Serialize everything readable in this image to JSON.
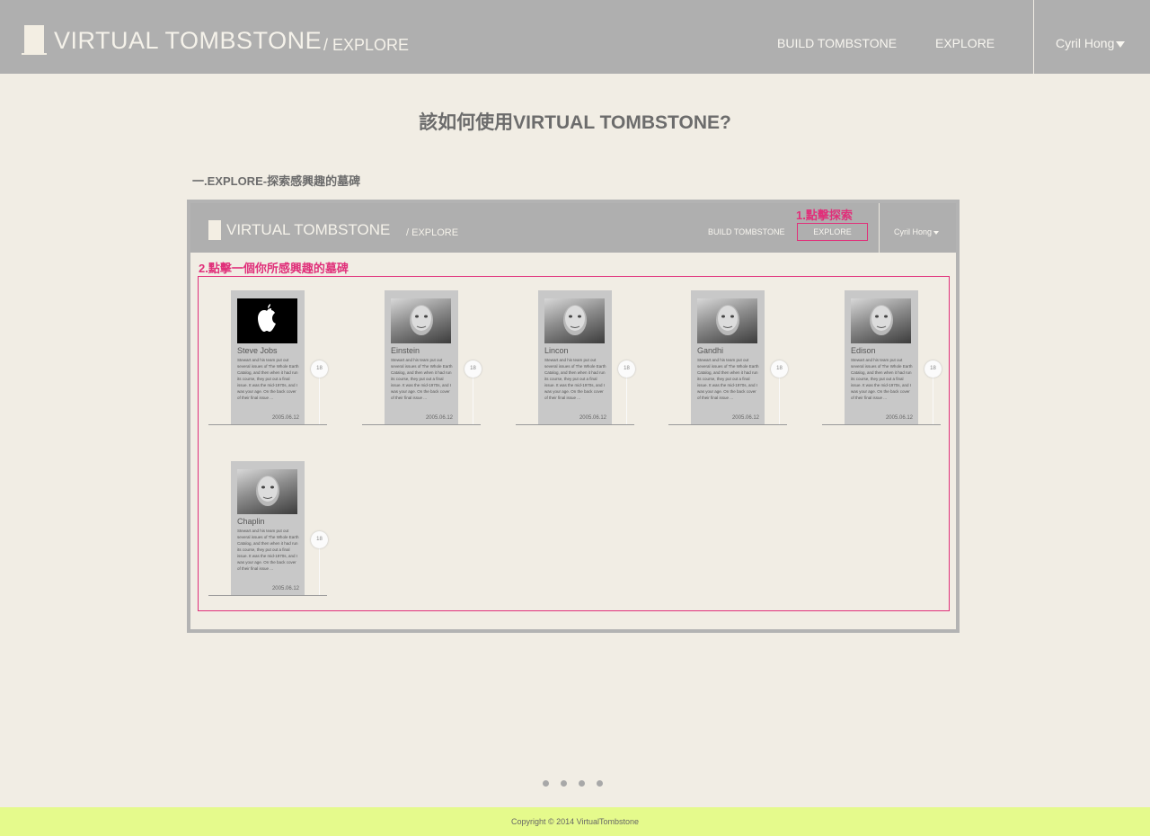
{
  "header": {
    "logo_title": "VIRTUAL TOMBSTONE",
    "logo_sub": "/ EXPLORE",
    "nav_build": "BUILD TOMBSTONE",
    "nav_explore": "EXPLORE",
    "user_name": "Cyril Hong"
  },
  "main": {
    "title": "該如何使用VIRTUAL TOMBSTONE?",
    "section_title": "一.EXPLORE-探索感興趣的墓碑"
  },
  "mock": {
    "logo_title": "VIRTUAL TOMBSTONE",
    "logo_sub": "/ EXPLORE",
    "nav_build": "BUILD TOMBSTONE",
    "nav_explore": "EXPLORE",
    "user_name": "Cyril Hong",
    "annotation_1": "1.點擊探索",
    "annotation_2": "2.點擊一個你所感興趣的墓碑",
    "tombs": [
      {
        "name": "Steve Jobs",
        "text": "Stewart and his team put out several issues of The Whole Earth Catalog, and then when it had run its course, they put out a final issue. It was the mid-1970s, and I was your age. On the back cover of their final issue ...",
        "date": "2005.06.12",
        "flowers": "18",
        "photo": "apple-logo"
      },
      {
        "name": "Einstein",
        "text": "Stewart and his team put out several issues of The Whole Earth Catalog, and then when it had run its course, they put out a final issue. It was the mid-1970s, and I was your age. On the back cover of their final issue ...",
        "date": "2005.06.12",
        "flowers": "18",
        "photo": "portrait"
      },
      {
        "name": "Lincon",
        "text": "Stewart and his team put out several issues of The Whole Earth Catalog, and then when it had run its course, they put out a final issue. It was the mid-1970s, and I was your age. On the back cover of their final issue ...",
        "date": "2005.06.12",
        "flowers": "18",
        "photo": "portrait"
      },
      {
        "name": "Gandhi",
        "text": "Stewart and his team put out several issues of The Whole Earth Catalog, and then when it had run its course, they put out a final issue. It was the mid-1970s, and I was your age. On the back cover of their final issue ...",
        "date": "2005.06.12",
        "flowers": "18",
        "photo": "portrait"
      },
      {
        "name": "Edison",
        "text": "Stewart and his team put out several issues of The Whole Earth Catalog, and then when it had run its course, they put out a final issue. It was the mid-1970s, and I was your age. On the back cover of their final issue ...",
        "date": "2005.06.12",
        "flowers": "18",
        "photo": "portrait"
      },
      {
        "name": "Chaplin",
        "text": "Stewart and his team put out several issues of The Whole Earth Catalog, and then when it had run its course, they put out a final issue. It was the mid-1970s, and I was your age. On the back cover of their final issue ...",
        "date": "2005.06.12",
        "flowers": "18",
        "photo": "portrait"
      }
    ]
  },
  "pagination": {
    "pages": 4
  },
  "footer": {
    "copyright": "Copyright © 2014 VirtualTombstone"
  },
  "colors": {
    "header_bg": "#afafaf",
    "page_bg": "#f1ede4",
    "annotation": "#e0307a",
    "footer_bg": "#e5fa8c"
  }
}
